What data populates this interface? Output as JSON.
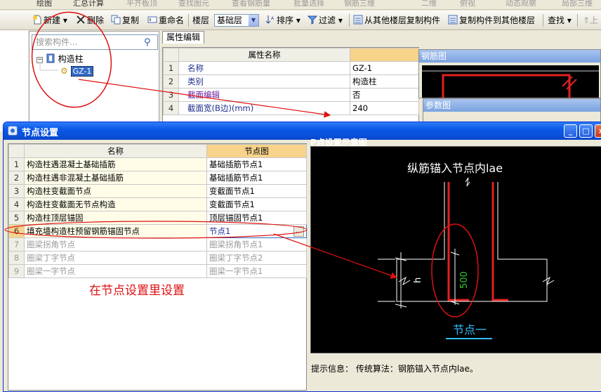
{
  "top_strip": {
    "items": [
      "绘图",
      "汇总计算",
      "平齐板顶",
      "查找图元",
      "查看钢筋量",
      "批量选择",
      "钢筋三维",
      "二维",
      "俯视",
      "动态观察",
      "局部三维"
    ]
  },
  "toolbar": {
    "new_label": "新建",
    "delete_label": "删除",
    "copy_label": "复制",
    "rename_label": "重命名",
    "floor_label": "楼层",
    "floor_value": "基础层",
    "sort_label": "排序",
    "filter_label": "过滤",
    "copy_from_other_label": "从其他楼层复制构件",
    "copy_to_other_label": "复制构件到其他楼层",
    "find_label": "查找",
    "up_label": "上"
  },
  "left_col": {
    "header": "ㄗ ×"
  },
  "tree": {
    "search_placeholder": "搜索构件...",
    "root_label": "构造柱",
    "child_label": "GZ-1"
  },
  "properties": {
    "tab_label": "属性编辑",
    "header_name": "属性名称",
    "header_value": "",
    "rows": [
      {
        "num": "1",
        "name": "名称",
        "value": "GZ-1"
      },
      {
        "num": "2",
        "name": "类别",
        "value": "构造柱"
      },
      {
        "num": "3",
        "name": "截面编辑",
        "value": "否"
      },
      {
        "num": "4",
        "name": "截面宽(B边)(mm)",
        "value": "240"
      }
    ]
  },
  "side_panels": {
    "rebar_title": "钢筋图",
    "param_title": "参数图"
  },
  "dialog": {
    "title": "节点设置",
    "col_name": "名称",
    "col_node": "节点图",
    "rows": [
      {
        "num": "1",
        "name": "构造柱遇混凝土基础插筋",
        "node": "基础插筋节点1"
      },
      {
        "num": "2",
        "name": "构造柱遇非混凝土基础插筋",
        "node": "基础插筋节点1"
      },
      {
        "num": "3",
        "name": "构造柱变截面节点",
        "node": "变截面节点1"
      },
      {
        "num": "4",
        "name": "构造柱变截面无节点构造",
        "node": "变截面节点1"
      },
      {
        "num": "5",
        "name": "构造柱顶层锚固",
        "node": "顶层锚固节点1"
      },
      {
        "num": "6",
        "name": "填充墙构造柱预留钢筋锚固节点",
        "node": "节点1"
      },
      {
        "num": "7",
        "name": "圈梁拐角节点",
        "node": "圈梁拐角节点1"
      },
      {
        "num": "8",
        "name": "圈梁丁字节点",
        "node": "圈梁丁字节点2"
      },
      {
        "num": "9",
        "name": "圈梁一字节点",
        "node": "圈梁一字节点1"
      }
    ],
    "preview_label": "P点设置示意图",
    "preview": {
      "title": "纵筋锚入节点内lae",
      "dim_h": "h",
      "dim_500": "500",
      "node_label": "节点一"
    },
    "hint_label": "提示信息：",
    "hint_text": "传统算法：钢筋锚入节点内lae。"
  },
  "annotation": {
    "text": "在节点设置里设置"
  },
  "colors": {
    "annotation": "#dd1111",
    "rebar": "#e02020",
    "dimension": "#ffffff",
    "dim_value": "#33cc33",
    "node_label": "#33bbff",
    "titlebar": "#0a58e6"
  }
}
